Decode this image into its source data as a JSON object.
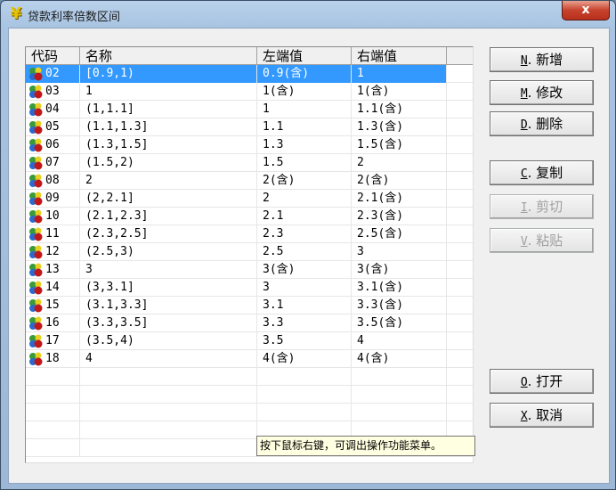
{
  "window": {
    "title": "贷款利率倍数区间",
    "title_icon": "yen-icon",
    "close": "x"
  },
  "grid": {
    "columns": [
      "代码",
      "名称",
      "左端值",
      "右端值"
    ],
    "selected_index": 0,
    "rows": [
      {
        "code": "02",
        "name": " [0.9,1)",
        "left": "0.9(含)",
        "right": "1"
      },
      {
        "code": "03",
        "name": "1",
        "left": "1(含)",
        "right": "1(含)"
      },
      {
        "code": "04",
        "name": "(1,1.1]",
        "left": "1",
        "right": "1.1(含)"
      },
      {
        "code": "05",
        "name": "(1.1,1.3]",
        "left": "1.1",
        "right": "1.3(含)"
      },
      {
        "code": "06",
        "name": "(1.3,1.5]",
        "left": "1.3",
        "right": "1.5(含)"
      },
      {
        "code": "07",
        "name": "(1.5,2)",
        "left": "1.5",
        "right": "2"
      },
      {
        "code": "08",
        "name": "2",
        "left": "2(含)",
        "right": "2(含)"
      },
      {
        "code": "09",
        "name": "(2,2.1]",
        "left": "2",
        "right": "2.1(含)"
      },
      {
        "code": "10",
        "name": "(2.1,2.3]",
        "left": "2.1",
        "right": "2.3(含)"
      },
      {
        "code": "11",
        "name": "(2.3,2.5]",
        "left": "2.3",
        "right": "2.5(含)"
      },
      {
        "code": "12",
        "name": "(2.5,3)",
        "left": "2.5",
        "right": "3"
      },
      {
        "code": "13",
        "name": "3",
        "left": "3(含)",
        "right": "3(含)"
      },
      {
        "code": "14",
        "name": "(3,3.1]",
        "left": "3",
        "right": "3.1(含)"
      },
      {
        "code": "15",
        "name": "(3.1,3.3]",
        "left": "3.1",
        "right": "3.3(含)"
      },
      {
        "code": "16",
        "name": "(3.3,3.5]",
        "left": "3.3",
        "right": "3.5(含)"
      },
      {
        "code": "17",
        "name": "(3.5,4)",
        "left": "3.5",
        "right": "4"
      },
      {
        "code": "18",
        "name": "4",
        "left": "4(含)",
        "right": "4(含)"
      }
    ]
  },
  "buttons": [
    {
      "key": "N",
      "label": ". 新增",
      "enabled": true
    },
    {
      "key": "M",
      "label": ". 修改",
      "enabled": true
    },
    {
      "key": "D",
      "label": ". 删除",
      "enabled": true
    },
    {
      "key": "C",
      "label": ". 复制",
      "enabled": true
    },
    {
      "key": "I",
      "label": ". 剪切",
      "enabled": false
    },
    {
      "key": "V",
      "label": ". 粘贴",
      "enabled": false
    },
    {
      "key": "O",
      "label": ". 打开",
      "enabled": true
    },
    {
      "key": "X",
      "label": ". 取消",
      "enabled": true
    }
  ],
  "tooltip": "按下鼠标右键，可调出操作功能菜单。"
}
